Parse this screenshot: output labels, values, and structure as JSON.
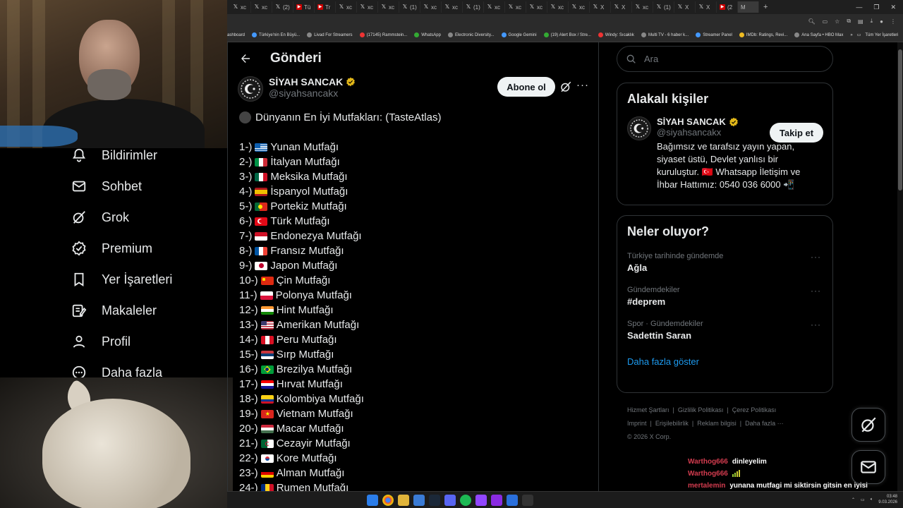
{
  "browser": {
    "tabs": [
      {
        "icon": "x-icon",
        "label": "xc"
      },
      {
        "icon": "x-icon",
        "label": "xc"
      },
      {
        "icon": "x-icon",
        "label": "(2)"
      },
      {
        "icon": "red",
        "label": "Tü"
      },
      {
        "icon": "red",
        "label": "Tr"
      },
      {
        "icon": "x-icon",
        "label": "xc"
      },
      {
        "icon": "x-icon",
        "label": "xc"
      },
      {
        "icon": "x-icon",
        "label": "xc"
      },
      {
        "icon": "x-icon",
        "label": "(1)"
      },
      {
        "icon": "x-icon",
        "label": "xc"
      },
      {
        "icon": "x-icon",
        "label": "xc"
      },
      {
        "icon": "x-icon",
        "label": "(1)"
      },
      {
        "icon": "x-icon",
        "label": "xc"
      },
      {
        "icon": "x-icon",
        "label": "xc"
      },
      {
        "icon": "x-icon",
        "label": "xc"
      },
      {
        "icon": "x-icon",
        "label": "xc"
      },
      {
        "icon": "x-icon",
        "label": "xc"
      },
      {
        "icon": "x-icon",
        "label": "X"
      },
      {
        "icon": "x-icon",
        "label": "X"
      },
      {
        "icon": "x-icon",
        "label": "xc"
      },
      {
        "icon": "x-icon",
        "label": "(1)"
      },
      {
        "icon": "x-icon",
        "label": "X"
      },
      {
        "icon": "x-icon",
        "label": "X"
      },
      {
        "icon": "red",
        "label": "(2"
      }
    ],
    "active_tab_label": "M",
    "new_tab": "+",
    "bookmarks": [
      {
        "dot": "",
        "label": "ashboard"
      },
      {
        "dot": "b",
        "label": "Türkiye'nin En Büyü..."
      },
      {
        "dot": "",
        "label": "Livad For Streamers"
      },
      {
        "dot": "r",
        "label": "(17145) Rammstein..."
      },
      {
        "dot": "g",
        "label": "WhatsApp"
      },
      {
        "dot": "",
        "label": "Electronic Diversity..."
      },
      {
        "dot": "b",
        "label": "Google Gemini"
      },
      {
        "dot": "g",
        "label": "(19) Alert Box / Stre..."
      },
      {
        "dot": "r",
        "label": "Windy: Sıcaklık"
      },
      {
        "dot": "",
        "label": "Multi TV - 6 haber k..."
      },
      {
        "dot": "b",
        "label": "Streamer Panel"
      },
      {
        "dot": "y",
        "label": "IMDb: Ratings, Revi..."
      },
      {
        "dot": "",
        "label": "Ana Sayfa • HBO Max"
      }
    ],
    "bookmarks_more": "»",
    "all_bookmarks": "Tüm Yer İşaretleri"
  },
  "nav": {
    "items": [
      {
        "name": "notifications",
        "icon": "bell-icon",
        "label": "Bildirimler"
      },
      {
        "name": "messages",
        "icon": "mail-icon",
        "label": "Sohbet"
      },
      {
        "name": "grok",
        "icon": "grok-icon",
        "label": "Grok"
      },
      {
        "name": "premium",
        "icon": "verified-icon",
        "label": "Premium"
      },
      {
        "name": "bookmarks",
        "icon": "bookmark-icon",
        "label": "Yer İşaretleri"
      },
      {
        "name": "articles",
        "icon": "article-icon",
        "label": "Makaleler"
      },
      {
        "name": "profile",
        "icon": "person-icon",
        "label": "Profil"
      },
      {
        "name": "more",
        "icon": "more-circle-icon",
        "label": "Daha fazla"
      }
    ]
  },
  "post": {
    "header_title": "Gönderi",
    "author_name": "SİYAH SANCAK",
    "author_handle": "@siyahsancakx",
    "subscribe_label": "Abone ol",
    "headline": "Dünyanın En İyi Mutfakları: (TasteAtlas)",
    "list": [
      {
        "rank": "1-)",
        "flag": "gr",
        "text": "Yunan Mutfağı"
      },
      {
        "rank": "2-)",
        "flag": "it",
        "text": "İtalyan Mutfağı"
      },
      {
        "rank": "3-)",
        "flag": "mx",
        "text": "Meksika Mutfağı"
      },
      {
        "rank": "4-)",
        "flag": "es",
        "text": "İspanyol Mutfağı"
      },
      {
        "rank": "5-)",
        "flag": "pt",
        "text": "Portekiz Mutfağı"
      },
      {
        "rank": "6-)",
        "flag": "tr",
        "text": "Türk Mutfağı"
      },
      {
        "rank": "7-)",
        "flag": "id",
        "text": "Endonezya Mutfağı"
      },
      {
        "rank": "8-)",
        "flag": "fr",
        "text": "Fransız Mutfağı"
      },
      {
        "rank": "9-)",
        "flag": "jp",
        "text": "Japon Mutfağı"
      },
      {
        "rank": "10-)",
        "flag": "cn",
        "text": "Çin Mutfağı"
      },
      {
        "rank": "11-)",
        "flag": "pl",
        "text": "Polonya Mutfağı"
      },
      {
        "rank": "12-)",
        "flag": "in",
        "text": "Hint Mutfağı"
      },
      {
        "rank": "13-)",
        "flag": "us",
        "text": "Amerikan Mutfağı"
      },
      {
        "rank": "14-)",
        "flag": "pe",
        "text": "Peru Mutfağı"
      },
      {
        "rank": "15-)",
        "flag": "rs",
        "text": "Sırp Mutfağı"
      },
      {
        "rank": "16-)",
        "flag": "br",
        "text": "Brezilya Mutfağı"
      },
      {
        "rank": "17-)",
        "flag": "hr",
        "text": "Hırvat Mutfağı"
      },
      {
        "rank": "18-)",
        "flag": "co",
        "text": "Kolombiya Mutfağı"
      },
      {
        "rank": "19-)",
        "flag": "vn",
        "text": "Vietnam Mutfağı"
      },
      {
        "rank": "20-)",
        "flag": "hu",
        "text": "Macar Mutfağı"
      },
      {
        "rank": "21-)",
        "flag": "dz",
        "text": "Cezayir Mutfağı"
      },
      {
        "rank": "22-)",
        "flag": "kr",
        "text": "Kore Mutfağı"
      },
      {
        "rank": "23-)",
        "flag": "de",
        "text": "Alman Mutfağı"
      },
      {
        "rank": "24-)",
        "flag": "ro",
        "text": "Rumen Mutfağı"
      }
    ]
  },
  "sidebar": {
    "search_placeholder": "Ara",
    "related_title": "Alakalı kişiler",
    "related": {
      "name": "SİYAH SANCAK",
      "handle": "@siyahsancakx",
      "bio": "Bağımsız ve tarafsız yayın yapan, siyaset üstü, Devlet yanlısı bir kuruluştur. 🇹🇷 Whatsapp İletişim ve İhbar Hattımız: 0540 036 6000 📲",
      "follow_label": "Takip et"
    },
    "trends_title": "Neler oluyor?",
    "trends": [
      {
        "meta": "Türkiye tarihinde gündemde",
        "topic": "Ağla"
      },
      {
        "meta": "Gündemdekiler",
        "topic": "#deprem"
      },
      {
        "meta": "Spor · Gündemdekiler",
        "topic": "Sadettin Saran"
      }
    ],
    "show_more": "Daha fazla göster",
    "footer_links": [
      "Hizmet Şartları",
      "Gizlilik Politikası",
      "Çerez Politikası",
      "Imprint",
      "Erişilebilirlik",
      "Reklam bilgisi",
      "Daha fazla ···"
    ],
    "copyright": "© 2026 X Corp."
  },
  "chat": [
    {
      "user": "Warthog666",
      "msg": "dinleyelim"
    },
    {
      "user": "Warthog666",
      "msg": ""
    },
    {
      "user": "mertalemin",
      "msg": "yunana mutfagi mi siktirsin gitsin en iyisi italyandir"
    }
  ],
  "taskbar": {
    "time": "03:48",
    "date": "9.03.2026"
  },
  "colors": {
    "accent": "#1d9bf0",
    "background": "#000000",
    "border": "#2f3336",
    "muted": "#71767b",
    "verified": "#e2b719",
    "chat_user": "#d43c4f"
  }
}
